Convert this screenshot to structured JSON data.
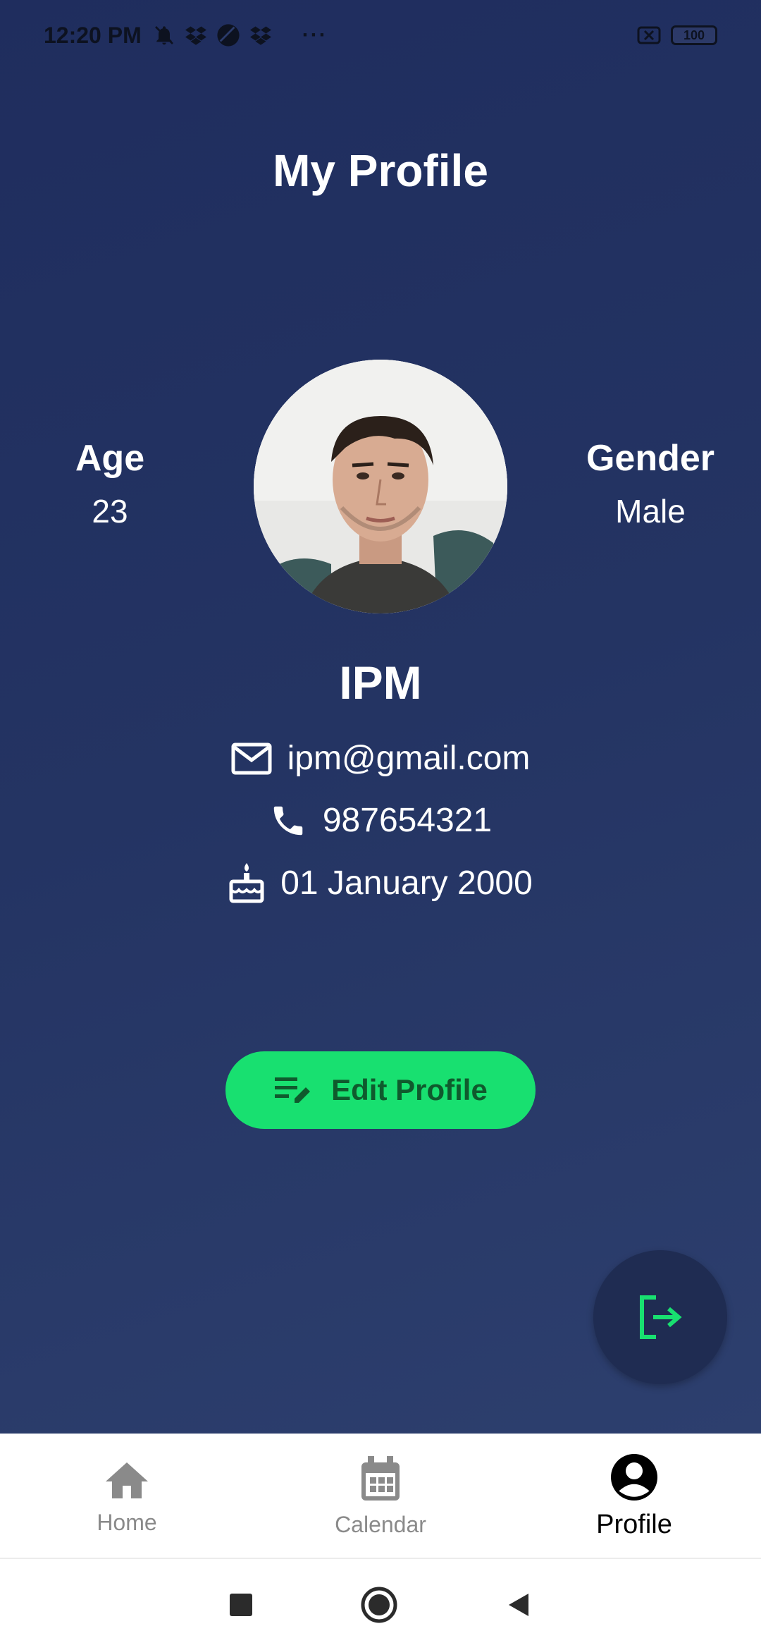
{
  "status_bar": {
    "time": "12:20 PM",
    "battery": "100",
    "icons": [
      "bell-off-icon",
      "dropbox-icon",
      "circle-icon",
      "dropbox-icon",
      "more-dots-icon",
      "close-box-icon"
    ]
  },
  "header": {
    "title": "My Profile"
  },
  "profile": {
    "age_label": "Age",
    "age_value": "23",
    "gender_label": "Gender",
    "gender_value": "Male",
    "name": "IPM",
    "email": "ipm@gmail.com",
    "phone": "987654321",
    "birthday": "01 January 2000"
  },
  "actions": {
    "edit_label": "Edit Profile",
    "logout_icon": "logout-icon"
  },
  "bottom_nav": {
    "items": [
      {
        "label": "Home",
        "icon": "home-icon"
      },
      {
        "label": "Calendar",
        "icon": "calendar-icon"
      },
      {
        "label": "Profile",
        "icon": "account-circle-icon"
      }
    ],
    "active": "Profile"
  },
  "colors": {
    "accent": "#18e070",
    "background": "#243463",
    "text": "#ffffff"
  }
}
